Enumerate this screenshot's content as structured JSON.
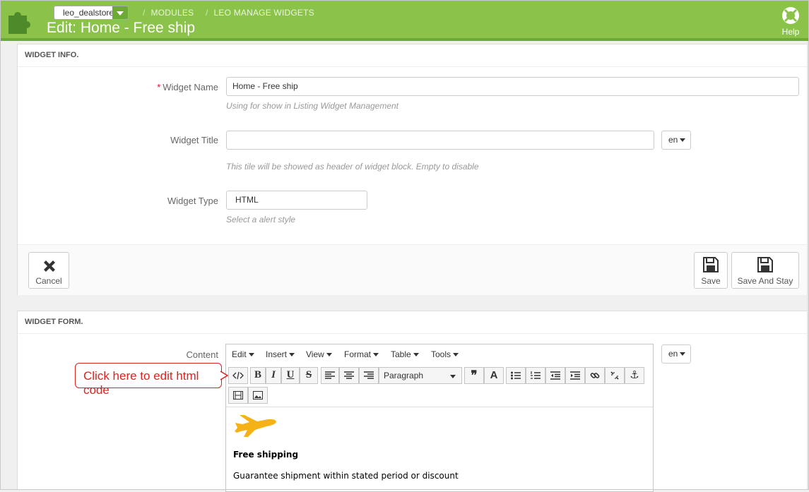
{
  "header": {
    "shop_name": "leo_dealstore",
    "breadcrumbs": [
      "MODULES",
      "LEO MANAGE WIDGETS"
    ],
    "title": "Edit: Home - Free ship",
    "help_label": "Help",
    "accent": "#8bc34a"
  },
  "widget_info": {
    "heading": "WIDGET INFO.",
    "name_label": "Widget Name",
    "name_value": "Home - Free ship",
    "name_help": "Using for show in Listing Widget Management",
    "title_label": "Widget Title",
    "title_value": "",
    "title_lang": "en",
    "title_help": "This tile will be showed as header of widget block. Empty to disable",
    "type_label": "Widget Type",
    "type_value": "HTML",
    "type_help": "Select a alert style",
    "cancel_label": "Cancel",
    "save_label": "Save",
    "save_stay_label": "Save And Stay"
  },
  "widget_form": {
    "heading": "WIDGET FORM.",
    "content_label": "Content",
    "content_lang": "en",
    "menus": [
      "Edit",
      "Insert",
      "View",
      "Format",
      "Table",
      "Tools"
    ],
    "format_select": "Paragraph",
    "callout": "Click here to edit html code",
    "content": {
      "title": "Free shipping",
      "text": "Guarantee shipment within stated period or discount",
      "icon": "airplane-icon",
      "icon_color": "#f5b217"
    }
  }
}
